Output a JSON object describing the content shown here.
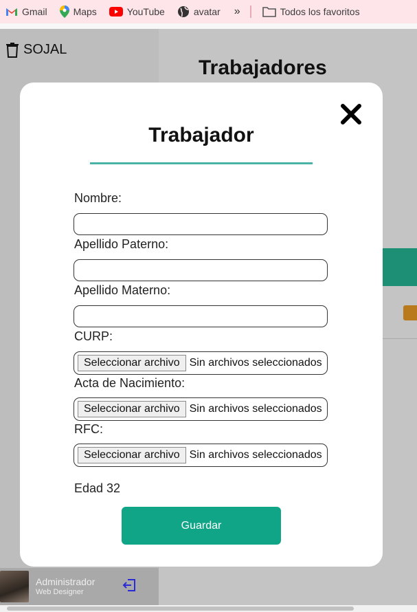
{
  "bookmarks": {
    "items": [
      {
        "label": "Gmail",
        "icon": "gmail-icon"
      },
      {
        "label": "Maps",
        "icon": "maps-icon"
      },
      {
        "label": "YouTube",
        "icon": "youtube-icon"
      },
      {
        "label": "avatar",
        "icon": "globe-icon"
      }
    ],
    "overflow": "»",
    "folder_label": "Todos los favoritos"
  },
  "app": {
    "brand": "SOJAL",
    "page_title": "Trabajadores",
    "user": {
      "name": "Administrador",
      "role": "Web Designer"
    },
    "accent_color": "#11a587"
  },
  "modal": {
    "title": "Trabajador",
    "close_glyph": "✖",
    "fields": [
      {
        "label": "Nombre:",
        "value": ""
      },
      {
        "label": "Apellido Paterno:",
        "value": ""
      },
      {
        "label": "Apellido Materno:",
        "value": ""
      }
    ],
    "file_fields": [
      {
        "label": "CURP:",
        "button": "Seleccionar archivo",
        "status": "Sin archivos seleccionados"
      },
      {
        "label": "Acta de Nacimiento:",
        "button": "Seleccionar archivo",
        "status": "Sin archivos seleccionados"
      },
      {
        "label": "RFC:",
        "button": "Seleccionar archivo",
        "status": "Sin archivos seleccionados"
      }
    ],
    "edad": "Edad 32",
    "save_label": "Guardar"
  }
}
